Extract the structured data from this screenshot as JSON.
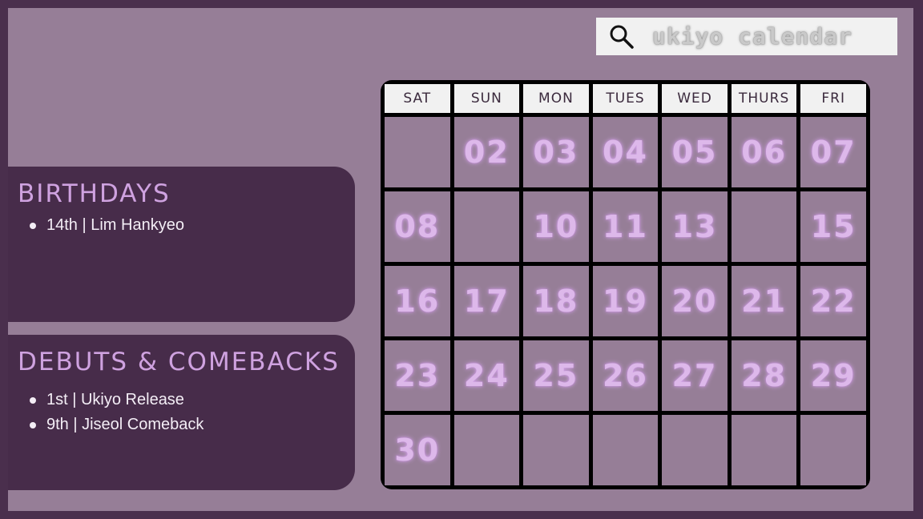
{
  "search": {
    "text": "ukiyo calendar",
    "icon": "search-icon"
  },
  "birthdays": {
    "title": "Birthdays",
    "items": [
      "14th | Lim Hankyeo"
    ]
  },
  "debuts": {
    "title": "Debuts & Comebacks",
    "items": [
      "1st | Ukiyo Release",
      "9th | Jiseol Comeback"
    ]
  },
  "calendar": {
    "days": [
      "SAT",
      "SUN",
      "MON",
      "TUES",
      "WED",
      "THURS",
      "FRI"
    ],
    "cells": [
      "",
      "02",
      "03",
      "04",
      "05",
      "06",
      "07",
      "08",
      "",
      "10",
      "11",
      "13",
      "",
      "15",
      "16",
      "17",
      "18",
      "19",
      "20",
      "21",
      "22",
      "23",
      "24",
      "25",
      "26",
      "27",
      "28",
      "29",
      "30",
      "",
      "",
      "",
      "",
      "",
      ""
    ]
  },
  "colors": {
    "background": "#967e97",
    "panel": "#472c4a",
    "accent": "#cfa2e0"
  }
}
